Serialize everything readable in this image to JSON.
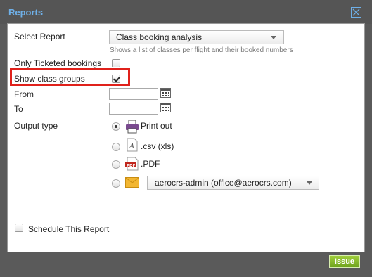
{
  "dialog": {
    "title": "Reports"
  },
  "form": {
    "select_report_label": "Select Report",
    "select_report_value": "Class booking analysis",
    "select_report_hint": "Shows a list of classes per flight and their booked numbers",
    "only_ticketed_label": "Only Ticketed bookings",
    "only_ticketed_checked": false,
    "show_class_groups_label": "Show class groups",
    "show_class_groups_checked": true,
    "from_label": "From",
    "from_value": "",
    "to_label": "To",
    "to_value": "",
    "output_type_label": "Output type",
    "output_options": [
      {
        "label": "Print out",
        "icon": "printer-icon",
        "selected": true
      },
      {
        "label": ".csv (xls)",
        "icon": "csv-file-icon",
        "selected": false
      },
      {
        "label": ".PDF",
        "icon": "pdf-file-icon",
        "selected": false
      },
      {
        "label": "",
        "icon": "email-envelope-icon",
        "selected": false
      }
    ],
    "email_recipient_value": "aerocrs-admin (office@aerocrs.com)",
    "schedule_label": "Schedule This Report",
    "schedule_checked": false
  },
  "buttons": {
    "issue_label": "Issue"
  },
  "colors": {
    "title": "#6fb0e8",
    "highlight": "#e0211b",
    "issue_button": "#7fb52a"
  }
}
